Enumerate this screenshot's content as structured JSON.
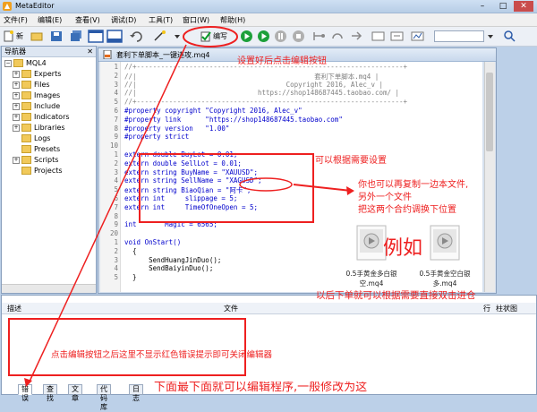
{
  "window": {
    "title": "MetaEditor",
    "min": "–",
    "max": "□",
    "close": "✕"
  },
  "menu": [
    "文件(F)",
    "编辑(E)",
    "查看(V)",
    "调试(D)",
    "工具(T)",
    "窗口(W)",
    "帮助(H)"
  ],
  "toolbar": {
    "new_label": "新",
    "compile_label": "编写",
    "navigator_label": "导航器"
  },
  "navigator": {
    "title": "导航器",
    "root": "MQL4",
    "items": [
      "Experts",
      "Files",
      "Images",
      "Include",
      "Indicators",
      "Libraries",
      "Logs",
      "Presets",
      "Scripts",
      "Projects"
    ]
  },
  "document": {
    "tab_title": "套利下单脚本_一键进攻.mq4"
  },
  "code": {
    "lines": [
      {
        "n": "1",
        "t": "//+------------------------------------------------------------------+"
      },
      {
        "n": "2",
        "t": "//|                                            套利下单脚本.mq4 |"
      },
      {
        "n": "3",
        "t": "//|                                     Copyright 2016, Alec_v |"
      },
      {
        "n": "4",
        "t": "//|                              https://shop148687445.taobao.com/ |"
      },
      {
        "n": "5",
        "t": "//+------------------------------------------------------------------+"
      },
      {
        "n": "6",
        "t": "#property copyright \"Copyright 2016, Alec_v\""
      },
      {
        "n": "7",
        "t": "#property link      \"https://shop148687445.taobao.com\""
      },
      {
        "n": "8",
        "t": "#property version   \"1.00\""
      },
      {
        "n": "9",
        "t": "#property strict"
      },
      {
        "n": "10",
        "t": ""
      },
      {
        "n": "1",
        "t": "extern double BuyLot = 0.01;"
      },
      {
        "n": "2",
        "t": "extern double SellLot = 0.01;"
      },
      {
        "n": "3",
        "t": "extern string BuyName = \"XAUUSD\";"
      },
      {
        "n": "4",
        "t": "extern string SellName = \"XAGUSD\";"
      },
      {
        "n": "5",
        "t": "extern string BiaoQian = \"阿卡\";"
      },
      {
        "n": "6",
        "t": "extern int     slippage = 5;"
      },
      {
        "n": "7",
        "t": "extern int     TimeOfOneOpen = 5;"
      },
      {
        "n": "8",
        "t": ""
      },
      {
        "n": "9",
        "t": "int       Magic = 6565;"
      },
      {
        "n": "20",
        "t": ""
      },
      {
        "n": "1",
        "t": "void OnStart()"
      },
      {
        "n": "2",
        "t": "  {"
      },
      {
        "n": "3",
        "t": "      SendHuangJinDuo();"
      },
      {
        "n": "4",
        "t": "      SendBaiyinDuo();"
      },
      {
        "n": "5",
        "t": "  }"
      }
    ]
  },
  "annotations": {
    "compile_hint": "设置好后点击编辑按钮",
    "modify_hint": "可以根据需要设置",
    "copy_hint_1": "你也可以再复制一边本文件,",
    "copy_hint_2": "另外一个文件",
    "copy_hint_3": "把这两个合约调换下位置",
    "example": "例如",
    "double_click_hint": "以后下单就可以根据需要直接双击进仓",
    "error_hint": "点击编辑按钮之后这里不显示红色错误提示即可关闭编辑器",
    "bottom_cut_hint": "下面最下面就可以编辑程序,一般修改为这"
  },
  "thumbnails": [
    {
      "caption_1": "0.5手黄金多白银",
      "caption_2": "空.mq4"
    },
    {
      "caption_1": "0.5手黄金空白银",
      "caption_2": "多.mq4"
    }
  ],
  "errors_panel": {
    "col_description": "描述",
    "col_file": "文件",
    "col_line": "行",
    "col_column": "柱状图"
  },
  "bottom_tabs": [
    "错误",
    "查找",
    "文章",
    "代码库",
    "日志"
  ],
  "colors": {
    "annotation_red": "#ee2020",
    "keyword_blue": "#0000cc",
    "string_green": "#008000",
    "comment_gray": "#808080"
  }
}
